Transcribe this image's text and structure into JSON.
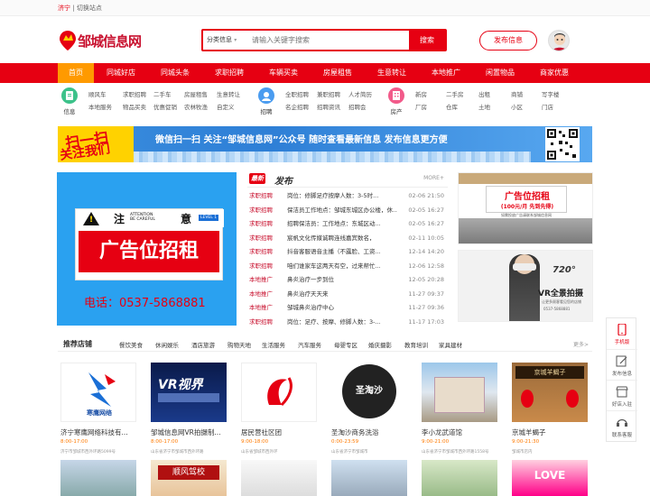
{
  "topbar": {
    "city": "济宁",
    "separator": "|",
    "switch_label": "切换站点"
  },
  "header": {
    "site_name": "邹城信息网"
  },
  "search": {
    "category": "分类信息",
    "placeholder": "请输入关键字搜索",
    "button": "搜索"
  },
  "post_button": "发布信息",
  "nav": [
    "首页",
    "同城好店",
    "同城头条",
    "求职招聘",
    "车辆买卖",
    "房屋租售",
    "生意转让",
    "本地推广",
    "闲置物品",
    "商家优惠"
  ],
  "categories": [
    {
      "label": "信息",
      "links": [
        [
          "顺风车",
          "求职招聘",
          "二手车",
          "房屋租售",
          "生意转让"
        ],
        [
          "本地服务",
          "物品买卖",
          "优惠促销",
          "农林牧渔",
          "自定义"
        ]
      ]
    },
    {
      "label": "招聘",
      "links": [
        [
          "全职招聘",
          "兼职招聘",
          "人才简历"
        ],
        [
          "名企招聘",
          "招聘资讯",
          "招聘会"
        ]
      ]
    },
    {
      "label": "房产",
      "links": [
        [
          "新房",
          "二手房",
          "出租",
          "商铺",
          "写字楼"
        ],
        [
          "厂房",
          "仓库",
          "土地",
          "小区",
          "门店"
        ]
      ]
    }
  ],
  "banner": {
    "scan_line1": "扫一扫",
    "scan_line2": "关注我们",
    "text": "微信扫一扫  关注“邹城信息网”公众号 随时查看最新信息 发布信息更方便"
  },
  "slider": {
    "zhu": "注",
    "yi": "意",
    "attention": "ATTENTION\nBE CAREFUL",
    "level": "LEVEL 1",
    "ad_text": "广告位招租",
    "phone": "电话：0537-5868881"
  },
  "newest": {
    "badge": "最新",
    "title": "发布",
    "more": "MORE+",
    "rows": [
      {
        "cat": "求职招聘",
        "title": "岗位：修脚足疗按摩人数：3-5时...",
        "date": "02-06 21:50"
      },
      {
        "cat": "求职招聘",
        "title": "保洁员工作地点：邹城东城区办公楼，休...",
        "date": "02-05 16:27"
      },
      {
        "cat": "求职招聘",
        "title": "招聘保洁员：工作地点：东城区动...",
        "date": "02-05 16:27"
      },
      {
        "cat": "求职招聘",
        "title": "宸帆文化传媒诚聘连线嘉宾数名，",
        "date": "02-11 10:05"
      },
      {
        "cat": "求职招聘",
        "title": "抖音客服语音主播（不露脸、工资...",
        "date": "12-14 14:20"
      },
      {
        "cat": "求职招聘",
        "title": "咱们谁家车这两天有空，过来帮忙...",
        "date": "12-06 12:58"
      },
      {
        "cat": "本地推广",
        "title": "鼻炎治疗一步到位",
        "date": "12-05 20:28"
      },
      {
        "cat": "本地推广",
        "title": "鼻炎治疗天天来",
        "date": "11-27 09:37"
      },
      {
        "cat": "本地推广",
        "title": "邹城鼻炎治疗中心",
        "date": "11-27 09:36"
      },
      {
        "cat": "求职招聘",
        "title": "岗位：足疗、按摩、修脚人数：3-...",
        "date": "11-17 17:03"
      }
    ]
  },
  "ad1": {
    "title": "广告位招租",
    "sub": "(100元/月  先到先得)",
    "small": "如需投放广告请联系邹城信息网"
  },
  "ad2": {
    "number": "720°",
    "title": "VR全景拍摄",
    "sub": "让更多顾客看见您的店铺",
    "phone": "0537-5868881"
  },
  "stores": {
    "title": "推荐店铺",
    "tabs": [
      "餐饮美食",
      "休闲娱乐",
      "酒店旅游",
      "购物天地",
      "生活服务",
      "汽车服务",
      "母婴专区",
      "婚庆摄影",
      "教育培训",
      "家具建材"
    ],
    "more": "更多>",
    "items": [
      {
        "name": "济宁寒鹰网络科技有...",
        "hours": "8:00-17:00",
        "addr": "济宁市邹城市西外环路5099号",
        "logo": "寒鹰网络"
      },
      {
        "name": "邹城信息网VR拍摄制...",
        "hours": "8:00-17:00",
        "addr": "山东省济宁市邹城市西外环路",
        "logo": "VR视界"
      },
      {
        "name": "居民营社区团",
        "hours": "9:00-18:00",
        "addr": "山东省邹城市西外环",
        "logo": ""
      },
      {
        "name": "圣淘沙商务洗浴",
        "hours": "0:00-23:59",
        "addr": "山东省济宁市邹城市",
        "logo": "圣淘沙"
      },
      {
        "name": "李小龙武道馆",
        "hours": "9:00-21:00",
        "addr": "山东省济宁市邹城市西外环路1558号",
        "logo": ""
      },
      {
        "name": "京城羊蝎子",
        "hours": "9:00-21:30",
        "addr": "邹城市店内",
        "logo": "京城羊蝎子"
      }
    ]
  },
  "sidebar": [
    "手机版",
    "发布信息",
    "好店入驻",
    "联系客服"
  ],
  "colors": {
    "primary": "#e60012",
    "active_nav": "#ff9a00"
  }
}
